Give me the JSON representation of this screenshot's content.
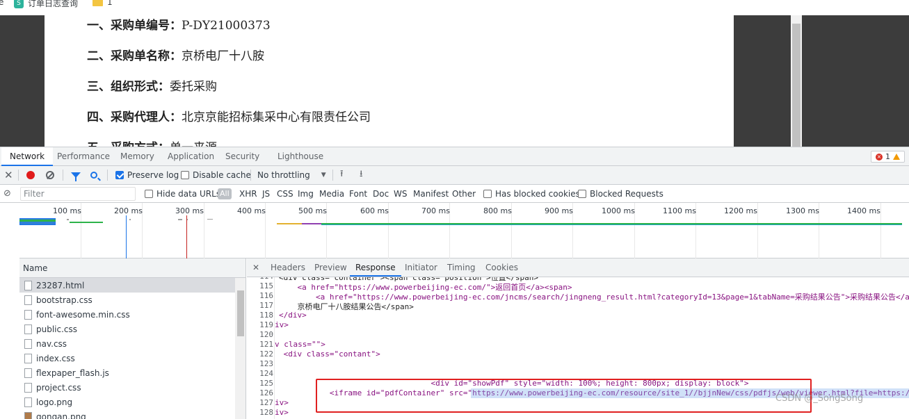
{
  "bookmarks": [
    {
      "label": "e",
      "icon": "none"
    },
    {
      "label": "订单日志查询",
      "icon": "app-icon"
    },
    {
      "label": "1",
      "icon": "folder-icon"
    }
  ],
  "page": {
    "lines": [
      {
        "label": "一、采购单编号：",
        "value": "P-DY21000373"
      },
      {
        "label": "二、采购单名称：",
        "value": "京桥电厂十八胺"
      },
      {
        "label": "三、组织形式：",
        "value": "委托采购"
      },
      {
        "label": "四、采购代理人：",
        "value": "北京京能招标集采中心有限责任公司"
      },
      {
        "label": "五、采购方式：",
        "value": "单一来源"
      }
    ]
  },
  "devtools": {
    "tabs": [
      "Network",
      "Performance",
      "Memory",
      "Application",
      "Security",
      "Lighthouse"
    ],
    "active_tab": "Network",
    "error_count": "1",
    "toolbar": {
      "preserve_log": "Preserve log",
      "disable_cache": "Disable cache",
      "throttling": "No throttling"
    },
    "filter": {
      "placeholder": "Filter",
      "hide_data_urls": "Hide data URLs",
      "all": "All",
      "types": [
        "XHR",
        "JS",
        "CSS",
        "Img",
        "Media",
        "Font",
        "Doc",
        "WS",
        "Manifest",
        "Other"
      ],
      "has_blocked_cookies": "Has blocked cookies",
      "blocked_requests": "Blocked Requests"
    },
    "timeline": {
      "ticks": [
        "100 ms",
        "200 ms",
        "300 ms",
        "400 ms",
        "500 ms",
        "600 ms",
        "700 ms",
        "800 ms",
        "900 ms",
        "1000 ms",
        "1100 ms",
        "1200 ms",
        "1300 ms",
        "1400 ms"
      ]
    },
    "requests": {
      "header": "Name",
      "items": [
        {
          "name": "23287.html",
          "selected": true,
          "kind": "doc"
        },
        {
          "name": "bootstrap.css",
          "kind": "doc"
        },
        {
          "name": "font-awesome.min.css",
          "kind": "doc"
        },
        {
          "name": "public.css",
          "kind": "doc"
        },
        {
          "name": "nav.css",
          "kind": "doc"
        },
        {
          "name": "index.css",
          "kind": "doc"
        },
        {
          "name": "flexpaper_flash.js",
          "kind": "doc"
        },
        {
          "name": "project.css",
          "kind": "doc"
        },
        {
          "name": "logo.png",
          "kind": "doc"
        },
        {
          "name": "gongan.png",
          "kind": "img"
        }
      ]
    },
    "detail": {
      "tabs": [
        "Headers",
        "Preview",
        "Response",
        "Initiator",
        "Timing",
        "Cookies"
      ],
      "active_tab": "Response",
      "lines": [
        {
          "n": "114",
          "text": "<div class=\"container\"><span class=\"position\">位置</span>"
        },
        {
          "n": "115",
          "text": "    <a href=\"https://www.powerbeijing-ec.com/\">返回首页</a><span>"
        },
        {
          "n": "116",
          "text": "        <a href=\"https://www.powerbeijing-ec.com/jncms/search/jingneng_result.html?categoryId=13&page=1&tabName=采购结果公告\">采购结果公告</a>"
        },
        {
          "n": "117",
          "text": "    京桥电厂十八胺结果公告</span>"
        },
        {
          "n": "118",
          "text": "</div>"
        },
        {
          "n": "119",
          "text": "iv>"
        },
        {
          "n": "120",
          "text": ""
        },
        {
          "n": "121",
          "text": "v class=\"\">"
        },
        {
          "n": "122",
          "text": " <div class=\"contant\">"
        },
        {
          "n": "123",
          "text": ""
        },
        {
          "n": "124",
          "text": ""
        },
        {
          "n": "125",
          "text": "                                 <div id=\"showPdf\" style=\"width: 100%; height: 800px; display: block\">"
        },
        {
          "n": "126",
          "text": "           <iframe id=\"pdfContainer\" src=\"https://www.powerbeijing-ec.com/resource/site_1//bjjnNew/css/pdfjs/web/viewer.html?file=https://"
        },
        {
          "n": "127",
          "text": "iv>"
        },
        {
          "n": "128",
          "text": "iv>"
        }
      ]
    }
  },
  "watermark": "CSDN @_SongSong"
}
